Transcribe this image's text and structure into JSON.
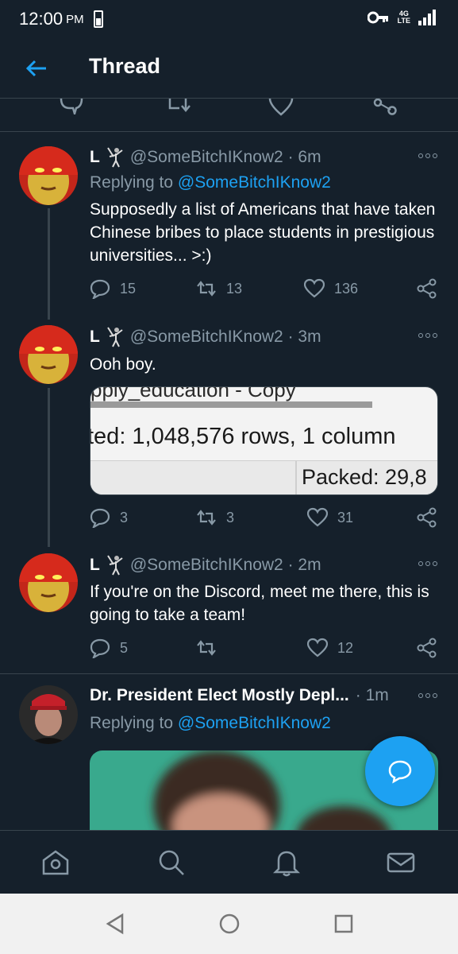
{
  "status_bar": {
    "time": "12:00",
    "ampm": "PM",
    "network_top": "4G",
    "network_bottom": "LTE"
  },
  "header": {
    "title": "Thread"
  },
  "tweets": [
    {
      "display_name": "L",
      "handle": "@SomeBitchIKnow2",
      "time": "· 6m",
      "replying_prefix": "Replying to",
      "replying_to": "@SomeBitchIKnow2",
      "text": "Supposedly a list of Americans that have taken Chinese bribes to place students in prestigious universities... >:)",
      "replies": "15",
      "retweets": "13",
      "likes": "136"
    },
    {
      "display_name": "L",
      "handle": "@SomeBitchIKnow2",
      "time": "· 3m",
      "text": "Ooh boy.",
      "media": {
        "top_text": "pply_education - Copy",
        "main_text": "ted: 1,048,576 rows, 1 column",
        "status_text": "Packed: 29,8"
      },
      "replies": "3",
      "retweets": "3",
      "likes": "31"
    },
    {
      "display_name": "L",
      "handle": "@SomeBitchIKnow2",
      "time": "· 2m",
      "text": "If you're on the Discord, meet me there, this is going to take a team!",
      "replies": "5",
      "retweets": "",
      "likes": "12"
    },
    {
      "display_name": "Dr. President Elect Mostly Depl...",
      "time": "· 1m",
      "replying_prefix": "Replying to",
      "replying_to": "@SomeBitchIKnow2"
    }
  ],
  "colors": {
    "background": "#15202b",
    "accent": "#1da1f2",
    "muted": "#8899a6",
    "divider": "#38444d"
  },
  "icons": {
    "back": "arrow-left-icon",
    "reply": "speech-bubble-icon",
    "retweet": "retweet-icon",
    "like": "heart-icon",
    "share": "share-icon",
    "more": "more-icon",
    "compose": "compose-reply-icon",
    "nav": [
      "home-icon",
      "search-icon",
      "bell-icon",
      "mail-icon"
    ]
  }
}
